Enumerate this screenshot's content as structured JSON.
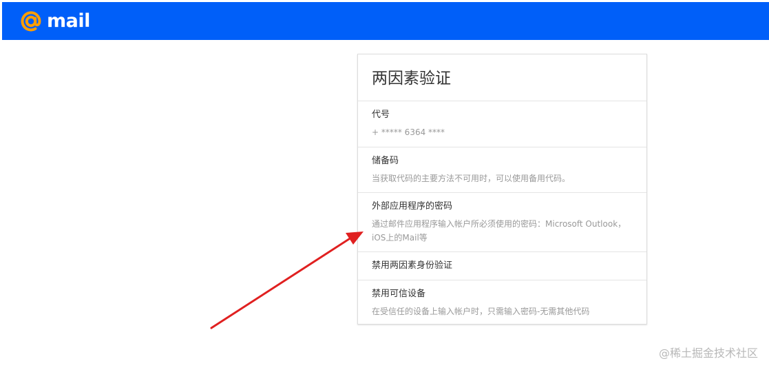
{
  "header": {
    "logo_text": "mail",
    "brand_color": "#005ff9",
    "logo_accent_color": "#ff9e00"
  },
  "card": {
    "title": "两因素验证",
    "items": [
      {
        "title": "代号",
        "description": "+ ***** 6364 ****"
      },
      {
        "title": "储备码",
        "description": "当获取代码的主要方法不可用时，可以使用备用代码。"
      },
      {
        "title": "外部应用程序的密码",
        "description": "通过邮件应用程序输入帐户所必须使用的密码：Microsoft Outlook，iOS上的Mail等"
      },
      {
        "title": "禁用两因素身份验证",
        "description": ""
      },
      {
        "title": "禁用可信设备",
        "description": "在受信任的设备上输入帐户时，只需输入密码-无需其他代码"
      }
    ]
  },
  "watermark": "@稀土掘金技术社区",
  "annotation": {
    "arrow_color": "#e02020"
  }
}
